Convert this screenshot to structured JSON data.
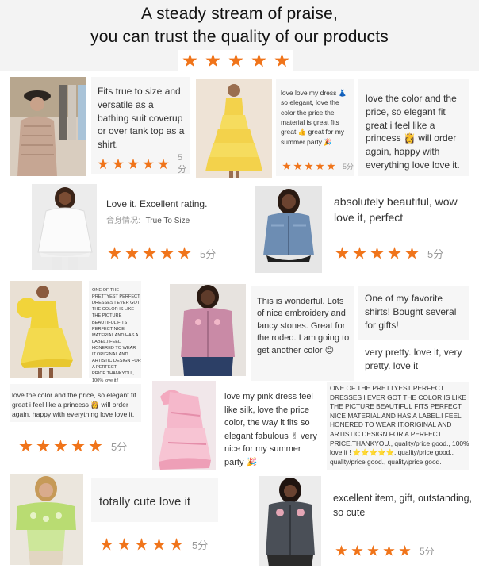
{
  "header": {
    "line1": "A steady stream of praise,",
    "line2": "you can trust the quality of our products"
  },
  "colors": {
    "star": "#f0741a",
    "header_bg": "#f3f3f3",
    "card_bg": "#f6f6f6"
  },
  "reviews": {
    "r1": {
      "text": "Fits true to size and versatile as a bathing suit coverup or over tank top as a shirt.",
      "score": "5分"
    },
    "r2": {
      "text": "love love my dress 👗 so elegant, love the color the price the material is great fits great 👍 great for my summer party 🎉",
      "score": "5分"
    },
    "r3": {
      "text": "love the color and the price, so elegant fit great i feel like a princess 👸 will order again, happy with everything love love it."
    },
    "r4": {
      "text": "Love it. Excellent rating.",
      "size_label": "合身情况:",
      "size_value": "True To Size",
      "score": "5分"
    },
    "r5": {
      "text": "absolutely beautiful, wow love it, perfect",
      "score": "5分"
    },
    "r6": {
      "text": "ONE OF THE PRETTYEST PERFECT DRESSES I EVER GOT THE COLOR IS LIKE THE PICTURE BEAUTIFUL FITS PERFECT NICE MATERIAL AND HAS A LABEL.I FEEL HONERED TO WEAR IT.ORIGINAL AND ARTISTIC DESIGN FOR A PERFECT PRICE.THANKYOU., 100% love it !"
    },
    "r7": {
      "text": "This is wonderful. Lots of nice embroidery and fancy stones. Great for the rodeo. I am going to get another color 😊"
    },
    "r8": {
      "text": "One of my favorite shirts! Bought several for gifts!",
      "text2": "very pretty. love it, very pretty. love it"
    },
    "r9": {
      "text": "love the color and the price, so elegant fit great i feel like a princess 👸 will order again, happy with everything love love it.",
      "score": "5分"
    },
    "r10": {
      "text": "love my pink dress feel like silk, love the price color, the way it fits so elegant fabulous ✌ very nice for my summer party 🎉"
    },
    "r11": {
      "text": "ONE OF THE PRETTYEST PERFECT DRESSES I EVER GOT THE COLOR IS LIKE THE PICTURE BEAUTIFUL FITS PERFECT NICE MATERIAL AND HAS A LABEL.I FEEL HONERED TO WEAR IT.ORIGINAL AND ARTISTIC DESIGN FOR A PERFECT PRICE.THANKYOU., quality/price good., 100% love it ! ⭐⭐⭐⭐⭐, quality/price good., quality/price good., quality/price good."
    },
    "r12": {
      "text": "totally cute love it",
      "score": "5分"
    },
    "r13": {
      "text": "excellent item, gift, outstanding, so cute",
      "score": "5分"
    }
  },
  "rating": 5
}
